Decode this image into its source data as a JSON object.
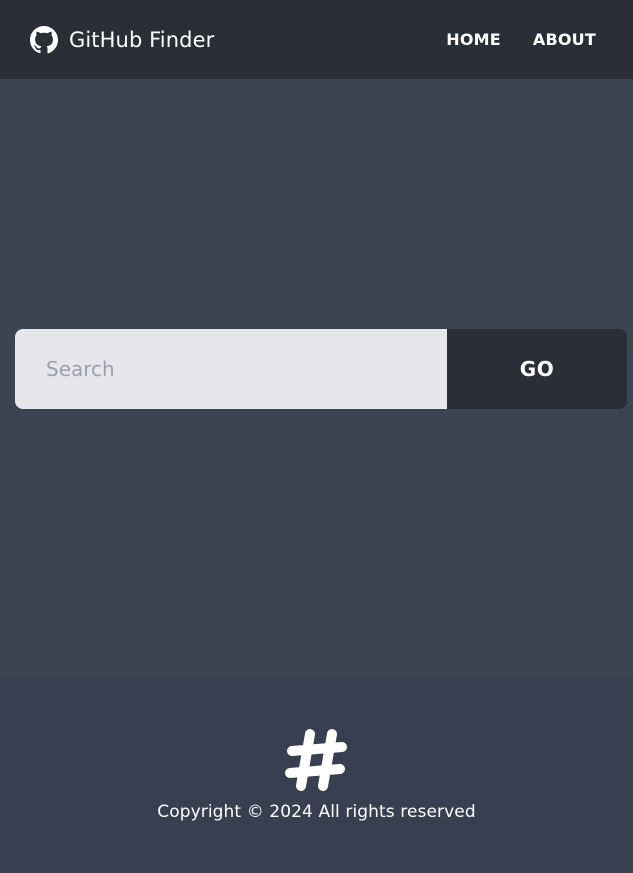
{
  "navbar": {
    "brand": {
      "icon": "github-icon",
      "title": "GitHub Finder"
    },
    "links": [
      {
        "label": "HOME"
      },
      {
        "label": "ABOUT"
      }
    ]
  },
  "search": {
    "placeholder": "Search",
    "value": "",
    "button_label": "GO"
  },
  "footer": {
    "icon": "hashtag-icon",
    "copyright": "Copyright © 2024 All rights reserved"
  },
  "colors": {
    "navbar_bg": "#2a2e37",
    "main_bg": "#3d4451",
    "footer_bg": "#373f51",
    "input_bg": "#e6e7eb",
    "button_bg": "#2a2e37",
    "text": "#ffffff"
  }
}
